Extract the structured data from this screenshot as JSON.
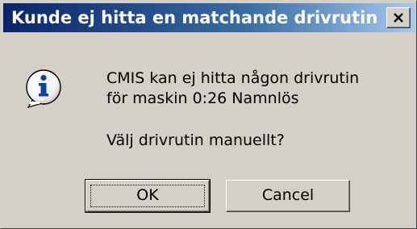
{
  "window": {
    "title": "Kunde ej hitta en matchande drivrutin",
    "close_icon": "close-icon"
  },
  "message": {
    "icon": "info-icon",
    "line1": "CMIS kan ej hitta någon drivrutin",
    "line2": "för maskin 0:26 Namnlös",
    "question": "Välj drivrutin manuellt?"
  },
  "buttons": {
    "ok_label": "OK",
    "cancel_label": "Cancel"
  },
  "colors": {
    "titlebar_start": "#0a246a",
    "titlebar_end": "#a6caf0",
    "dialog_bg": "#d4d0c8",
    "icon_blue": "#1040a0"
  }
}
